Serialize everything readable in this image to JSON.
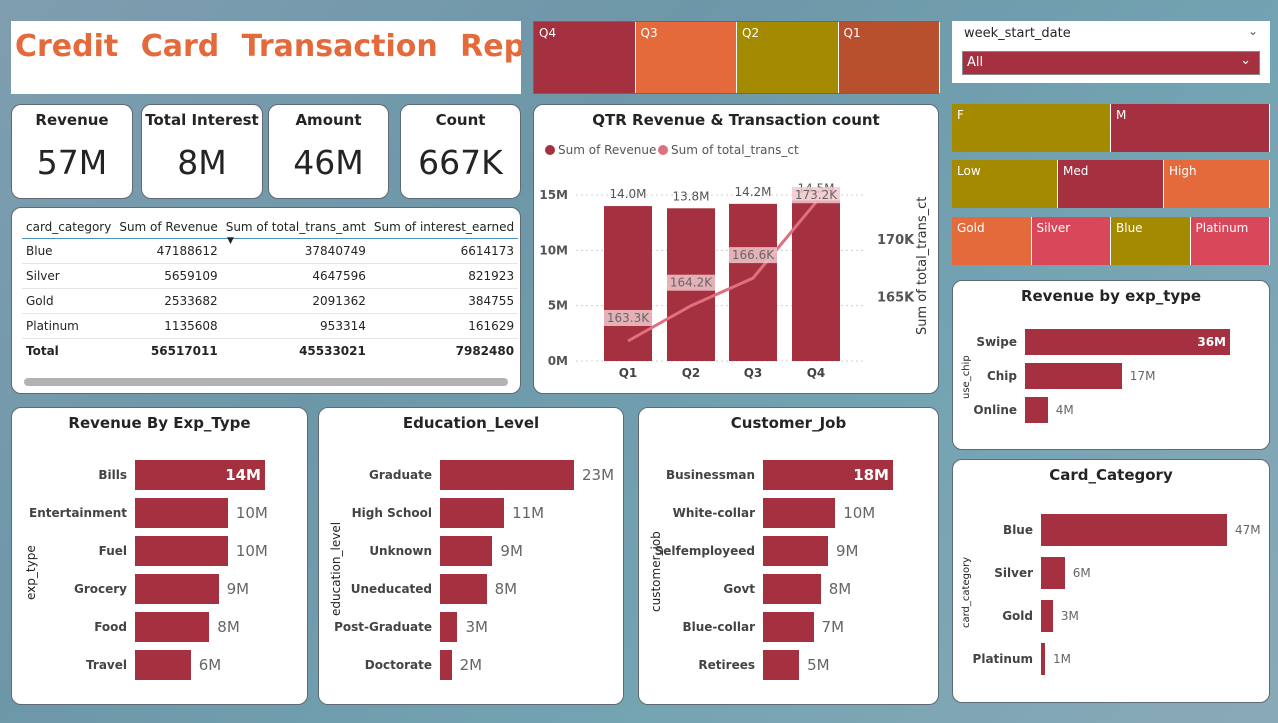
{
  "title": "Credit Card Transaction Report",
  "kpis": [
    {
      "label": "Revenue",
      "value": "57M"
    },
    {
      "label": "Total Interest",
      "value": "8M"
    },
    {
      "label": "Amount",
      "value": "46M"
    },
    {
      "label": "Count",
      "value": "667K"
    }
  ],
  "quarter_slicer": [
    {
      "label": "Q4",
      "color": "#a43040"
    },
    {
      "label": "Q3",
      "color": "#e46a3c"
    },
    {
      "label": "Q2",
      "color": "#a38a00"
    },
    {
      "label": "Q1",
      "color": "#b84f2d"
    }
  ],
  "week_slicer": {
    "label": "week_start_date",
    "selected": "All"
  },
  "gender_slicer": [
    {
      "label": "F",
      "color": "#a38a00"
    },
    {
      "label": "M",
      "color": "#a43040"
    }
  ],
  "income_slicer": [
    {
      "label": "Low",
      "color": "#a38a00"
    },
    {
      "label": "Med",
      "color": "#a43040"
    },
    {
      "label": "High",
      "color": "#e46a3c"
    }
  ],
  "card_slicer": [
    {
      "label": "Gold",
      "color": "#e46a3c"
    },
    {
      "label": "Silver",
      "color": "#d9475a"
    },
    {
      "label": "Blue",
      "color": "#a38a00"
    },
    {
      "label": "Platinum",
      "color": "#d9475a"
    }
  ],
  "table": {
    "headers": [
      "card_category",
      "Sum of Revenue",
      "Sum of total_trans_amt",
      "Sum of interest_earned"
    ],
    "rows": [
      [
        "Blue",
        "47188612",
        "37840749",
        "6614173"
      ],
      [
        "Silver",
        "5659109",
        "4647596",
        "821923"
      ],
      [
        "Gold",
        "2533682",
        "2091362",
        "384755"
      ],
      [
        "Platinum",
        "1135608",
        "953314",
        "161629"
      ]
    ],
    "total": [
      "Total",
      "56517011",
      "45533021",
      "7982480"
    ]
  },
  "qtr_chart": {
    "title": "QTR Revenue & Transaction count",
    "legend": [
      "Sum of Revenue",
      "Sum of total_trans_ct"
    ],
    "y_ticks": [
      "15M",
      "10M",
      "5M",
      "0M"
    ],
    "y2_ticks": [
      "170K",
      "165K"
    ],
    "y2_label": "Sum of total_trans_ct",
    "colors": {
      "bar": "#a43040",
      "line": "#e0707e"
    }
  },
  "chart_data": [
    {
      "type": "bar",
      "title": "QTR Revenue & Transaction count",
      "categories": [
        "Q1",
        "Q2",
        "Q3",
        "Q4"
      ],
      "series": [
        {
          "name": "Sum of Revenue",
          "values": [
            14.0,
            13.8,
            14.2,
            14.5
          ],
          "labels": [
            "14.0M",
            "13.8M",
            "14.2M",
            "14.5M"
          ]
        },
        {
          "name": "Sum of total_trans_ct",
          "values": [
            163.3,
            164.2,
            166.6,
            173.2
          ],
          "labels": [
            "163.3K",
            "164.2K",
            "166.6K",
            "173.2K"
          ]
        }
      ],
      "ylim": [
        0,
        15
      ],
      "y2lim": [
        162,
        174
      ]
    },
    {
      "type": "bar",
      "title": "Revenue by exp_type",
      "ylabel": "use_chip",
      "categories": [
        "Swipe",
        "Chip",
        "Online"
      ],
      "values": [
        36,
        17,
        4
      ],
      "labels": [
        "36M",
        "17M",
        "4M"
      ]
    },
    {
      "type": "bar",
      "title": "Revenue By Exp_Type",
      "ylabel": "exp_type",
      "categories": [
        "Bills",
        "Entertainment",
        "Fuel",
        "Grocery",
        "Food",
        "Travel"
      ],
      "values": [
        14,
        10,
        10,
        9,
        8,
        6
      ],
      "labels": [
        "14M",
        "10M",
        "10M",
        "9M",
        "8M",
        "6M"
      ]
    },
    {
      "type": "bar",
      "title": "Education_Level",
      "ylabel": "education_level",
      "categories": [
        "Graduate",
        "High School",
        "Unknown",
        "Uneducated",
        "Post-Graduate",
        "Doctorate"
      ],
      "values": [
        23,
        11,
        9,
        8,
        3,
        2
      ],
      "labels": [
        "23M",
        "11M",
        "9M",
        "8M",
        "3M",
        "2M"
      ]
    },
    {
      "type": "bar",
      "title": "Customer_Job",
      "ylabel": "customer_job",
      "categories": [
        "Businessman",
        "White-collar",
        "Selfemployeed",
        "Govt",
        "Blue-collar",
        "Retirees"
      ],
      "values": [
        18,
        10,
        9,
        8,
        7,
        5
      ],
      "labels": [
        "18M",
        "10M",
        "9M",
        "8M",
        "7M",
        "5M"
      ]
    },
    {
      "type": "bar",
      "title": "Card_Category",
      "ylabel": "card_category",
      "categories": [
        "Blue",
        "Silver",
        "Gold",
        "Platinum"
      ],
      "values": [
        47,
        6,
        3,
        1
      ],
      "labels": [
        "47M",
        "6M",
        "3M",
        "1M"
      ]
    }
  ]
}
